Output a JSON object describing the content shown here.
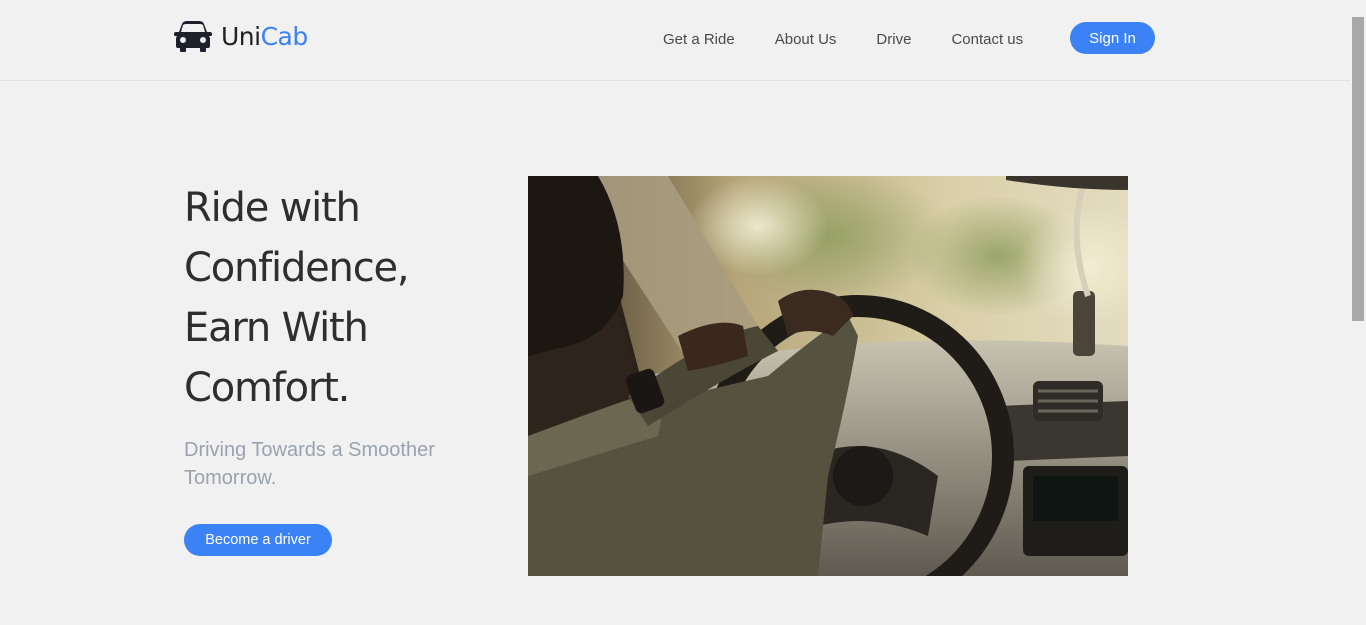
{
  "brand": {
    "name_part1": "Uni",
    "name_part2": "Cab",
    "logo_icon": "car-icon",
    "accent_color": "#3b82f6"
  },
  "nav": {
    "links": [
      {
        "label": "Get a Ride"
      },
      {
        "label": "About Us"
      },
      {
        "label": "Drive"
      },
      {
        "label": "Contact us"
      }
    ],
    "signin_label": "Sign In"
  },
  "hero": {
    "title_lines": [
      "Ride with",
      "Confidence,",
      "Earn With",
      "Comfort."
    ],
    "subtitle": "Driving Towards a Smoother Tomorrow.",
    "cta_label": "Become a driver"
  }
}
